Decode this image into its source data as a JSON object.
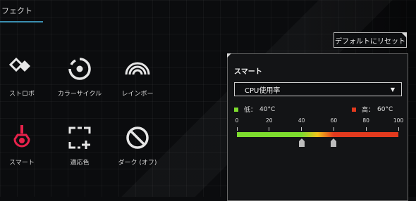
{
  "tab": {
    "label": "フェクト"
  },
  "effects": [
    {
      "name": "strobe",
      "label": "ストロボ",
      "icon": "strobe-diamond-icon"
    },
    {
      "name": "color-cycle",
      "label": "カラーサイクル",
      "icon": "color-cycle-icon"
    },
    {
      "name": "rainbow",
      "label": "レインボー",
      "icon": "rainbow-icon"
    },
    {
      "name": "smart",
      "label": "スマート",
      "icon": "smart-thermometer-icon",
      "selected": true
    },
    {
      "name": "adaptive-color",
      "label": "適応色",
      "icon": "adaptive-color-icon"
    },
    {
      "name": "dark-off",
      "label": "ダーク (オフ)",
      "icon": "dark-off-icon"
    }
  ],
  "reset_button": {
    "label": "デフォルトにリセット"
  },
  "smart_panel": {
    "title": "スマート",
    "source_select": {
      "value": "CPU使用率"
    },
    "low": {
      "label": "低：",
      "value": "40°C",
      "color": "#7ddc2e"
    },
    "high": {
      "label": "高：",
      "value": "60°C",
      "color": "#e23a1e"
    },
    "scale": {
      "ticks": [
        "0",
        "20",
        "40",
        "60",
        "80",
        "100"
      ],
      "min": 0,
      "max": 100
    },
    "thresholds": {
      "low": 40,
      "high": 60
    }
  },
  "colors": {
    "accent": "#3a8fb0",
    "selected_icon": "#e8224b",
    "icon_default": "#e6e6e6"
  }
}
